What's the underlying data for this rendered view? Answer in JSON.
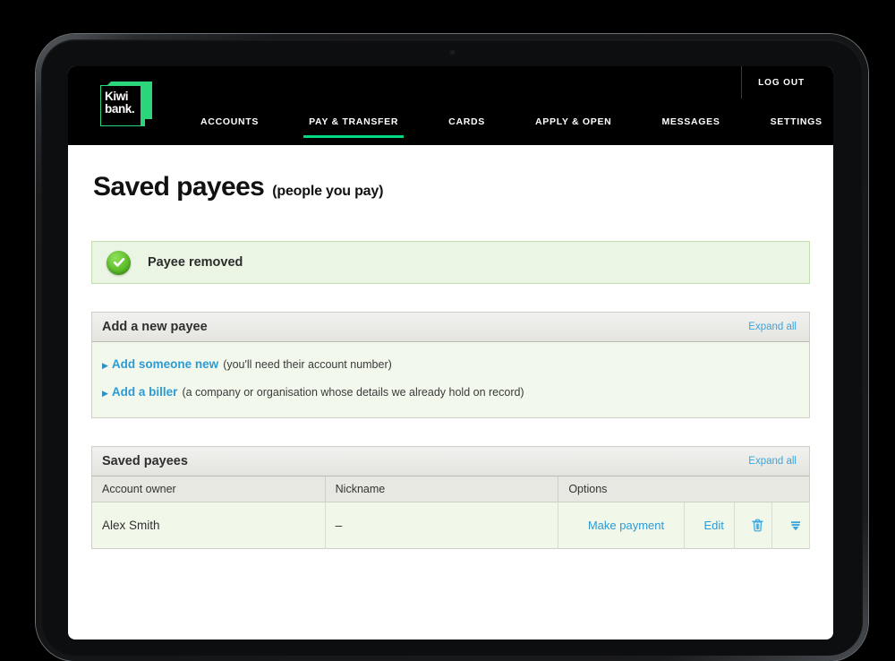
{
  "brand": {
    "logo_text": "Kiwi\nbank.",
    "green": "#2bd67b",
    "accent_link": "#2e9ad4",
    "nav_active_underline": "#00d97e"
  },
  "topbar": {
    "logout_label": "LOG OUT",
    "nav": [
      {
        "label": "ACCOUNTS",
        "active": false
      },
      {
        "label": "PAY & TRANSFER",
        "active": true
      },
      {
        "label": "CARDS",
        "active": false
      },
      {
        "label": "APPLY & OPEN",
        "active": false
      },
      {
        "label": "MESSAGES",
        "active": false
      },
      {
        "label": "SETTINGS",
        "active": false
      }
    ]
  },
  "page": {
    "title": "Saved payees",
    "subtitle": "(people you pay)"
  },
  "banner": {
    "message": "Payee removed",
    "icon": "check-circle-icon",
    "status_color": "#5fc02c",
    "background": "#eaf5e3"
  },
  "add_payee_panel": {
    "title": "Add a new payee",
    "expand_all_label": "Expand all",
    "rows": [
      {
        "link": "Add someone new",
        "note": "(you'll need their account number)"
      },
      {
        "link": "Add a biller",
        "note": "(a company or organisation whose details we already hold on record)"
      }
    ]
  },
  "saved_payees_panel": {
    "title": "Saved payees",
    "expand_all_label": "Expand all",
    "columns": [
      "Account owner",
      "Nickname",
      "Options"
    ],
    "rows": [
      {
        "account_owner": "Alex Smith",
        "nickname": "–",
        "options": {
          "make_payment_label": "Make payment",
          "edit_label": "Edit",
          "delete_icon": "trash-icon",
          "expand_icon": "expand-down-icon"
        }
      }
    ]
  }
}
